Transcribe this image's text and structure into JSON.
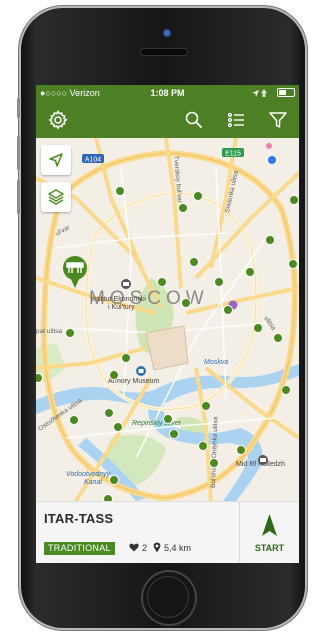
{
  "status_bar": {
    "carrier": "●○○○○ Verizon",
    "time": "1:08 PM"
  },
  "toolbar": {
    "icons": [
      "settings-icon",
      "search-icon",
      "list-icon",
      "filter-icon"
    ]
  },
  "map": {
    "city_label": "MOSCOW",
    "labels": {
      "institute": "Institut Ekonomiki",
      "institute_2": "i Kul'tury",
      "armory": "Armory Museum",
      "repinskiy": "Repinskiy skver",
      "vodootvodnyy": "Vodootvodnyy",
      "kanal": "Kanal",
      "kolledzh": "Mid Rf Kolledzh",
      "moskva": "Moskva",
      "a104": "A104",
      "e115": "E115",
      "tverskoy": "Tverskoy bul'var",
      "sretenka": "Sretenka ulitsa",
      "pat": "pat ulitsa",
      "ostozhenka": "Ostozhenka ulitsa",
      "ordynka": "Bol'shaya Ordynka ulitsa",
      "pokrovka": "ulitsa",
      "left_street": "ul'var"
    }
  },
  "place_card": {
    "title": "ITAR-TASS",
    "tag": "TRADITIONAL",
    "likes": "2",
    "distance": "5,4 km",
    "start_label": "START"
  },
  "colors": {
    "accent": "#4d7f24",
    "marker": "#4b8a1f"
  }
}
